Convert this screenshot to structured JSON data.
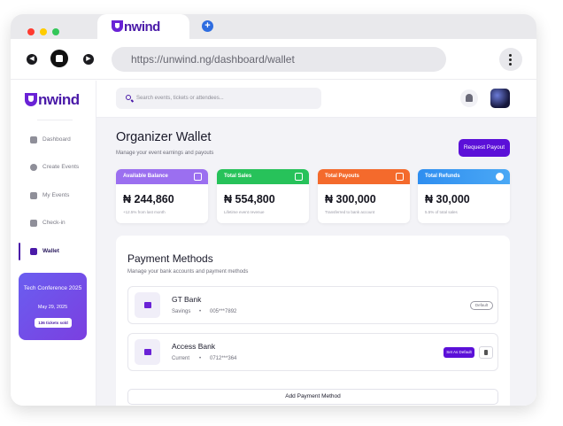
{
  "browser": {
    "tab_logo_text": "nwind",
    "new_tab_symbol": "+",
    "url": "https://unwind.ng/dashboard/wallet",
    "traffic_light_colors": [
      "#ff5f57",
      "#febc2e",
      "#28c840"
    ]
  },
  "sidebar": {
    "brand": "nwind",
    "items": [
      {
        "label": "Dashboard",
        "icon": "home-icon"
      },
      {
        "label": "Create Events",
        "icon": "plus-circle-icon"
      },
      {
        "label": "My Events",
        "icon": "calendar-icon"
      },
      {
        "label": "Check-in",
        "icon": "briefcase-icon"
      },
      {
        "label": "Wallet",
        "icon": "grid-icon",
        "active": true
      }
    ],
    "event_card": {
      "title": "Tech Conference 2025",
      "date": "May 29, 2025",
      "button": "136 tickets sold"
    }
  },
  "topbar": {
    "search_placeholder": "Search events, tickets or attendees...",
    "icons": [
      "search-icon",
      "bell-icon",
      "avatar"
    ]
  },
  "main": {
    "title": "Organizer Wallet",
    "subtitle": "Manage your event earnings and payouts",
    "request_button": "Request Payout",
    "stats": [
      {
        "label": "Available Balance",
        "value": "₦ 244,860",
        "note": "+12.5% from last month",
        "color": "#9b6ff0"
      },
      {
        "label": "Total Sales",
        "value": "₦ 554,800",
        "note": "Lifetime event revenue",
        "color": "#27c25a"
      },
      {
        "label": "Total Payouts",
        "value": "₦ 300,000",
        "note": "Transferred to bank account",
        "color": "#f46a2c"
      },
      {
        "label": "Total Refunds",
        "value": "₦ 30,000",
        "note": "5.5% of total sales",
        "color": "#3a8cf0"
      }
    ],
    "payment_methods": {
      "title": "Payment Methods",
      "subtitle": "Manage your bank accounts and payment methods",
      "banks": [
        {
          "name": "GT Bank",
          "type": "Savings",
          "separator": "•",
          "number": "005***7892",
          "default_badge": "Default"
        },
        {
          "name": "Access Bank",
          "type": "Current",
          "separator": "•",
          "number": "0712***364",
          "set_default": "Set As Default"
        }
      ],
      "add_button": "Add Payment Method"
    }
  }
}
